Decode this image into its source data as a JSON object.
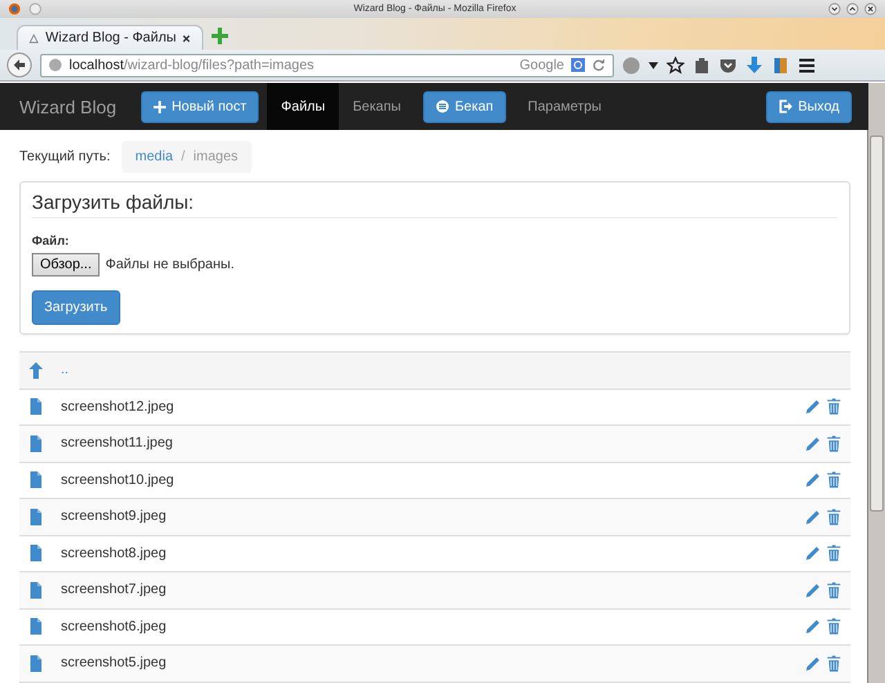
{
  "window": {
    "title": "Wizard Blog - Файлы - Mozilla Firefox"
  },
  "browser": {
    "tab": {
      "title": "Wizard Blog - Файлы"
    },
    "address": {
      "host": "localhost",
      "path": "/wizard-blog/files?path=images"
    },
    "search": {
      "placeholder": "Google"
    }
  },
  "navbar": {
    "brand": "Wizard Blog",
    "items": [
      {
        "kind": "create",
        "label": "Новый пост",
        "selected": false
      },
      {
        "kind": "link",
        "label": "Файлы",
        "selected": true
      },
      {
        "kind": "link",
        "label": "Бекапы",
        "selected": false
      },
      {
        "kind": "backup",
        "label": "Бекап",
        "selected": false
      },
      {
        "kind": "link",
        "label": "Параметры",
        "selected": false
      }
    ],
    "logout": {
      "label": "Выход"
    }
  },
  "path": {
    "label": "Текущий путь:",
    "separator": "/",
    "crumbs": [
      {
        "label": "media",
        "selected": false
      },
      {
        "label": "images",
        "selected": true
      }
    ]
  },
  "upload": {
    "title": "Загрузить файлы:",
    "field_label": "Файл:",
    "browse": "Обзор...",
    "status": "Файлы не выбраны.",
    "submit": "Загрузить"
  },
  "files": {
    "parent": "..",
    "rows": [
      {
        "name": "screenshot12.jpeg"
      },
      {
        "name": "screenshot11.jpeg"
      },
      {
        "name": "screenshot10.jpeg"
      },
      {
        "name": "screenshot9.jpeg"
      },
      {
        "name": "screenshot8.jpeg"
      },
      {
        "name": "screenshot7.jpeg"
      },
      {
        "name": "screenshot6.jpeg"
      },
      {
        "name": "screenshot5.jpeg"
      }
    ]
  }
}
